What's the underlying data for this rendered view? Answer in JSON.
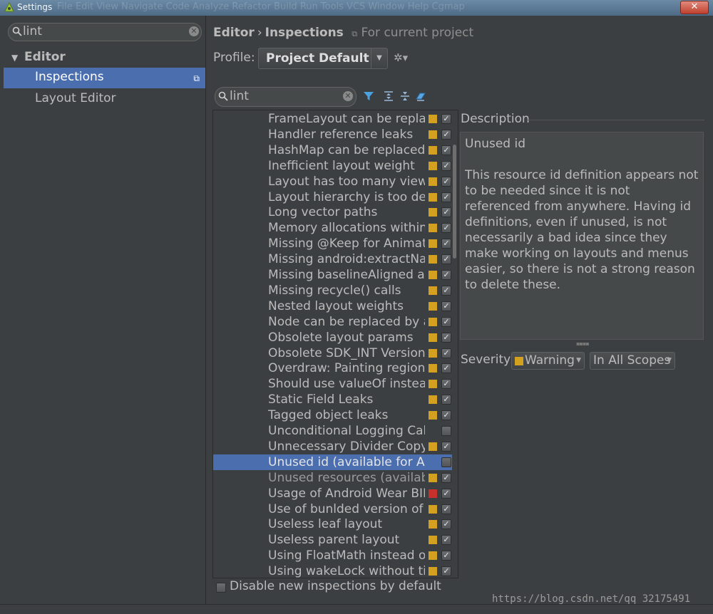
{
  "window": {
    "title": "Settings",
    "ghost_menu": "File  Edit  View  Navigate  Code  Analyze  Refactor  Build  Run  Tools  VCS  Window  Help  Cgmap",
    "close_glyph": "✕"
  },
  "left": {
    "search_value": "lint",
    "tree": {
      "editor_label": "Editor",
      "items": [
        {
          "label": "Inspections",
          "selected": true
        },
        {
          "label": "Layout Editor",
          "selected": false
        }
      ]
    }
  },
  "header": {
    "crumb_parent": "Editor",
    "crumb_sep": "›",
    "crumb_current": "Inspections",
    "scope_note": "For current project"
  },
  "profile": {
    "label": "Profile:",
    "value": "Project Default  Pr"
  },
  "inspection_search": {
    "value": "lint"
  },
  "inspections": [
    {
      "name": "FrameLayout can be replaced with <merge>",
      "severity": "warning",
      "checked": true
    },
    {
      "name": "Handler reference leaks",
      "severity": "warning",
      "checked": true
    },
    {
      "name": "HashMap can be replaced with SparseArray",
      "severity": "warning",
      "checked": true
    },
    {
      "name": "Inefficient layout weight",
      "severity": "warning",
      "checked": true
    },
    {
      "name": "Layout has too many views",
      "severity": "warning",
      "checked": true
    },
    {
      "name": "Layout hierarchy is too deep",
      "severity": "warning",
      "checked": true
    },
    {
      "name": "Long vector paths",
      "severity": "warning",
      "checked": true
    },
    {
      "name": "Memory allocations within drawing code",
      "severity": "warning",
      "checked": true
    },
    {
      "name": "Missing @Keep for Animated properties",
      "severity": "warning",
      "checked": true
    },
    {
      "name": "Missing android:extractNativeLibs",
      "severity": "warning",
      "checked": true
    },
    {
      "name": "Missing baselineAligned attribute",
      "severity": "warning",
      "checked": true
    },
    {
      "name": "Missing recycle() calls",
      "severity": "warning",
      "checked": true
    },
    {
      "name": "Nested layout weights",
      "severity": "warning",
      "checked": true
    },
    {
      "name": "Node can be replaced by a TextView",
      "severity": "warning",
      "checked": true
    },
    {
      "name": "Obsolete layout params",
      "severity": "warning",
      "checked": true
    },
    {
      "name": "Obsolete SDK_INT Version Check",
      "severity": "warning",
      "checked": true
    },
    {
      "name": "Overdraw: Painting regions more than once",
      "severity": "warning",
      "checked": true
    },
    {
      "name": "Should use valueOf instead of new",
      "severity": "warning",
      "checked": true
    },
    {
      "name": "Static Field Leaks",
      "severity": "warning",
      "checked": true
    },
    {
      "name": "Tagged object leaks",
      "severity": "warning",
      "checked": true
    },
    {
      "name": "Unconditional Logging Calls",
      "severity": "none",
      "checked": false
    },
    {
      "name": "Unnecessary Divider Copy",
      "severity": "warning",
      "checked": true
    },
    {
      "name": "Unused id (available for Analyze)",
      "severity": "none",
      "checked": false,
      "selected": true
    },
    {
      "name": "Unused resources (available for Analyze)",
      "severity": "warning",
      "checked": true,
      "dim": true
    },
    {
      "name": "Usage of Android Wear BIND_LISTENER",
      "severity": "error",
      "checked": true
    },
    {
      "name": "Use of bunlded version of GoogleApiClient",
      "severity": "warning",
      "checked": true
    },
    {
      "name": "Useless leaf layout",
      "severity": "warning",
      "checked": true
    },
    {
      "name": "Useless parent layout",
      "severity": "warning",
      "checked": true
    },
    {
      "name": "Using FloatMath instead of Math",
      "severity": "warning",
      "checked": true
    },
    {
      "name": "Using wakeLock without timeout",
      "severity": "warning",
      "checked": true
    }
  ],
  "description": {
    "title": "Description",
    "heading": "Unused id",
    "body": "This resource id definition appears not to be needed since it is not referenced from anywhere. Having id definitions, even if unused, is not necessarily a bad idea since they make working on layouts and menus easier, so there is not a strong reason to delete these."
  },
  "severity": {
    "label": "Severity:",
    "value": "Warning",
    "scope": "In All Scopes"
  },
  "bottom": {
    "disable_new_label": "Disable new inspections by default"
  },
  "watermark": "https://blog.csdn.net/qq_32175491",
  "colors": {
    "selection": "#4b6eaf",
    "warning": "#d4a020",
    "error": "#c8302c",
    "panel": "#3c3f41"
  }
}
